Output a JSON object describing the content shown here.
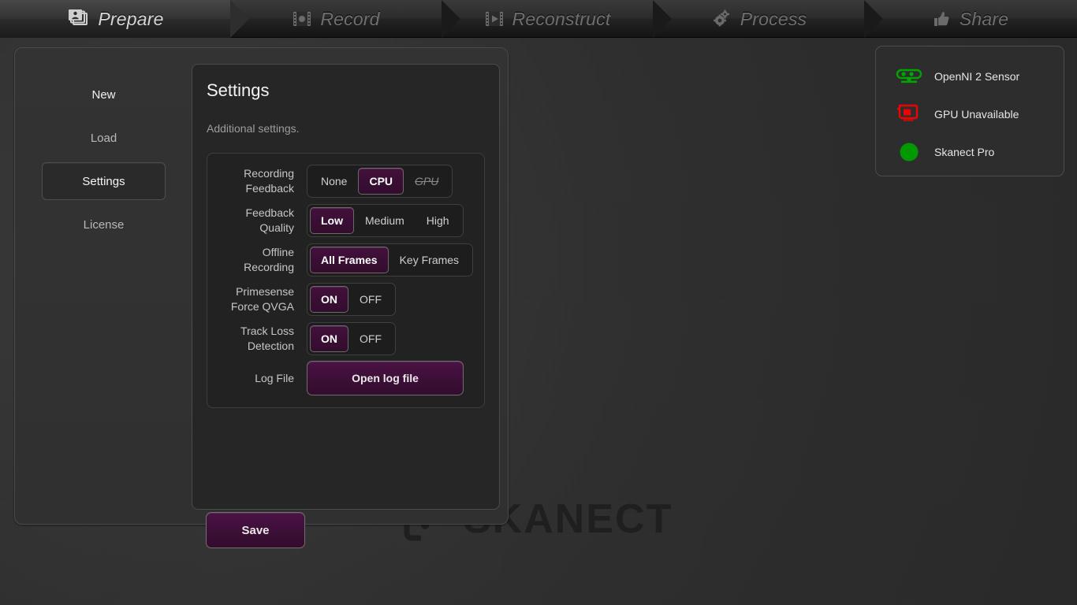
{
  "topnav": {
    "tabs": [
      {
        "id": "prepare",
        "label": "Prepare",
        "icon": "photos-icon",
        "active": true
      },
      {
        "id": "record",
        "label": "Record",
        "icon": "film-reel-icon",
        "active": false
      },
      {
        "id": "reconstruct",
        "label": "Reconstruct",
        "icon": "film-play-icon",
        "active": false
      },
      {
        "id": "process",
        "label": "Process",
        "icon": "gears-icon",
        "active": false
      },
      {
        "id": "share",
        "label": "Share",
        "icon": "thumbs-up-icon",
        "active": false
      }
    ]
  },
  "sidebar": {
    "items": [
      {
        "id": "new",
        "label": "New",
        "selected": false
      },
      {
        "id": "load",
        "label": "Load",
        "selected": false
      },
      {
        "id": "settings",
        "label": "Settings",
        "selected": true
      },
      {
        "id": "license",
        "label": "License",
        "selected": false
      }
    ]
  },
  "settings": {
    "title": "Settings",
    "subtitle": "Additional settings.",
    "rows": [
      {
        "id": "recording-feedback",
        "label": "Recording\nFeedback",
        "label_line1": "Recording",
        "label_line2": "Feedback",
        "options": [
          {
            "label": "None",
            "selected": false,
            "disabled": false
          },
          {
            "label": "CPU",
            "selected": true,
            "disabled": false
          },
          {
            "label": "GPU",
            "selected": false,
            "disabled": true
          }
        ]
      },
      {
        "id": "feedback-quality",
        "label_line1": "Feedback",
        "label_line2": "Quality",
        "options": [
          {
            "label": "Low",
            "selected": true,
            "disabled": false
          },
          {
            "label": "Medium",
            "selected": false,
            "disabled": false
          },
          {
            "label": "High",
            "selected": false,
            "disabled": false
          }
        ]
      },
      {
        "id": "offline-recording",
        "label_line1": "Offline",
        "label_line2": "Recording",
        "options": [
          {
            "label": "All Frames",
            "selected": true,
            "disabled": false
          },
          {
            "label": "Key Frames",
            "selected": false,
            "disabled": false
          }
        ]
      },
      {
        "id": "primesense-force-qvga",
        "label_line1": "Primesense",
        "label_line2": "Force QVGA",
        "options": [
          {
            "label": "ON",
            "selected": true,
            "disabled": false
          },
          {
            "label": "OFF",
            "selected": false,
            "disabled": false
          }
        ]
      },
      {
        "id": "track-loss-detection",
        "label_line1": "Track Loss",
        "label_line2": "Detection",
        "options": [
          {
            "label": "ON",
            "selected": true,
            "disabled": false
          },
          {
            "label": "OFF",
            "selected": false,
            "disabled": false
          }
        ]
      }
    ],
    "log_row": {
      "id": "log-file",
      "label": "Log File",
      "button_label": "Open log file"
    },
    "save_label": "Save"
  },
  "status": {
    "items": [
      {
        "id": "sensor",
        "label": "OpenNI 2 Sensor",
        "icon": "sensor-icon",
        "color": "#00a400"
      },
      {
        "id": "gpu",
        "label": "GPU Unavailable",
        "icon": "graphics-card-icon",
        "color": "#f00000"
      },
      {
        "id": "license",
        "label": "Skanect Pro",
        "icon": "green-dot-icon",
        "color": "#009a00"
      }
    ]
  },
  "watermark": {
    "text": "SKANECT",
    "color": "#1f1f1f"
  },
  "colors": {
    "accent_selected": "#3d1038",
    "panel_bg": "#262626",
    "app_bg": "#2f2f2f",
    "status_ok": "#00a400",
    "status_error": "#f00000"
  }
}
